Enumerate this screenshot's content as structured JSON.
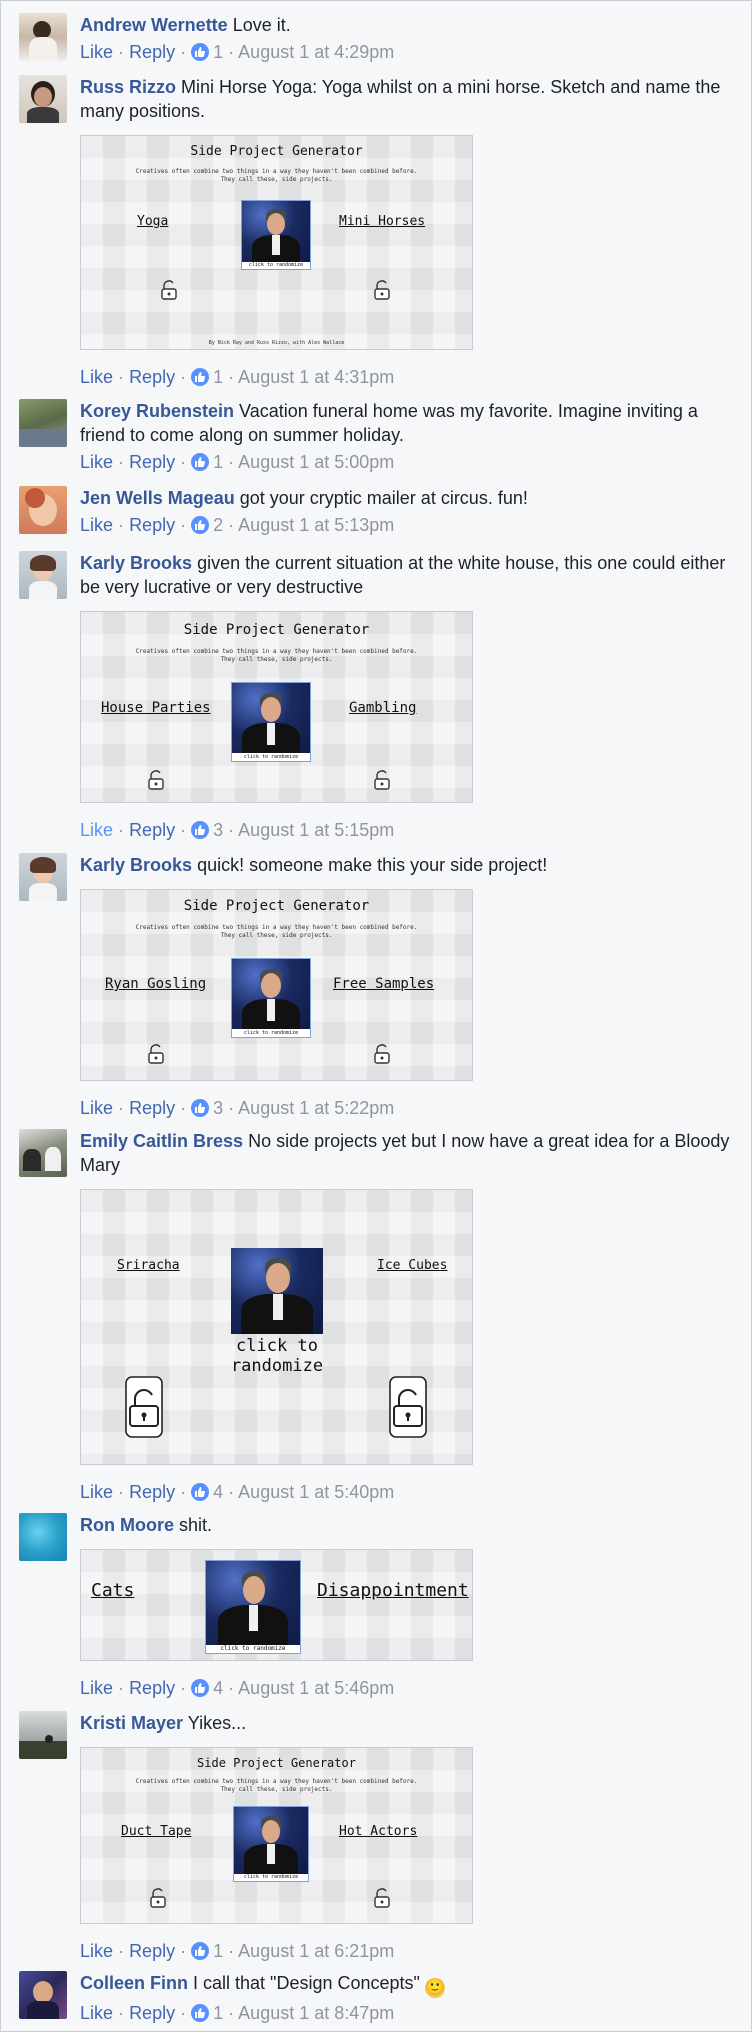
{
  "actions": {
    "like": "Like",
    "reply": "Reply",
    "sep": "·"
  },
  "gen": {
    "title": "Side Project Generator",
    "sub1": "Creatives often combine two things in a way they haven't been combined before.",
    "sub2": "They call these, side projects.",
    "caption": "click to randomize",
    "caption_large": "click to randomize",
    "credit": "By Nick Ray and Russ Rizzo, with Alex Wallace"
  },
  "comments": [
    {
      "author": "Andrew Wernette",
      "text": "Love it.",
      "likes": "1",
      "time": "August 1 at 4:29pm"
    },
    {
      "author": "Russ Rizzo",
      "text": "Mini Horse Yoga: Yoga whilst on a mini horse. Sketch and name the many positions.",
      "likes": "1",
      "time": "August 1 at 4:31pm",
      "embed": {
        "left": "Yoga",
        "right": "Mini Horses"
      }
    },
    {
      "author": "Korey Rubenstein",
      "text": "Vacation funeral home was my favorite. Imagine inviting a friend to come along on summer holiday.",
      "likes": "1",
      "time": "August 1 at 5:00pm"
    },
    {
      "author": "Jen Wells Mageau",
      "text": "got your cryptic mailer at circus. fun!",
      "likes": "2",
      "time": "August 1 at 5:13pm"
    },
    {
      "author": "Karly Brooks",
      "text": "given the current situation at the white house, this one could either be very lucrative or very destructive",
      "likes": "3",
      "time": "August 1 at 5:15pm",
      "embed": {
        "left": "House Parties",
        "right": "Gambling"
      }
    },
    {
      "author": "Karly Brooks",
      "text": "quick! someone make this your side project!",
      "likes": "3",
      "time": "August 1 at 5:22pm",
      "embed": {
        "left": "Ryan Gosling",
        "right": "Free Samples"
      }
    },
    {
      "author": "Emily Caitlin Bress",
      "text": "No side projects yet but I now have a great idea for a Bloody Mary",
      "likes": "4",
      "time": "August 1 at 5:40pm",
      "embed": {
        "left": "Sriracha",
        "right": "Ice Cubes"
      }
    },
    {
      "author": "Ron Moore",
      "text": "shit.",
      "likes": "4",
      "time": "August 1 at 5:46pm",
      "embed": {
        "left": "Cats",
        "right": "Disappointment"
      }
    },
    {
      "author": "Kristi Mayer",
      "text": "Yikes...",
      "likes": "1",
      "time": "August 1 at 6:21pm",
      "embed": {
        "left": "Duct Tape",
        "right": "Hot Actors"
      }
    },
    {
      "author": "Colleen Finn",
      "text": "I call that \"Design Concepts\"",
      "likes": "1",
      "time": "August 1 at 8:47pm",
      "emoji": "🙂"
    }
  ],
  "avatar_colors": [
    "#c8b8a8",
    "#5a4a3e",
    "#6a7a5a",
    "#d08a6a",
    "#b8c4cc",
    "#b8c4cc",
    "#8a9a8a",
    "#2aa0c8",
    "#4a5a6a",
    "#3a3a7a"
  ]
}
